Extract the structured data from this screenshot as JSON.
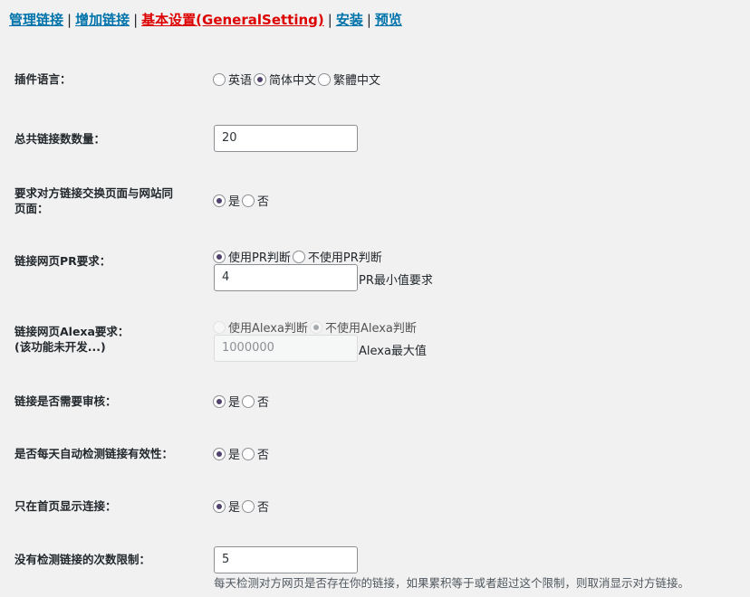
{
  "nav": {
    "items": [
      "管理链接",
      "增加链接",
      "基本设置(GeneralSetting)",
      "安装",
      "预览"
    ],
    "separator": "|",
    "active_color": "#dd0000",
    "link_color": "#0073aa"
  },
  "settings": {
    "language": {
      "label": "插件语言：",
      "options": [
        "英语",
        "简体中文",
        "繁體中文"
      ],
      "selected": "简体中文"
    },
    "total_links": {
      "label": "总共链接数数量：",
      "value": "20"
    },
    "same_page": {
      "label_line1": "要求对方链接交换页面与网站同",
      "label_line2": "页面：",
      "options": [
        "是",
        "否"
      ],
      "selected": "是"
    },
    "pr": {
      "label": "链接网页PR要求：",
      "options": [
        "使用PR判断",
        "不使用PR判断"
      ],
      "selected": "使用PR判断",
      "value": "4",
      "suffix": "PR最小值要求"
    },
    "alexa": {
      "label_line1": "链接网页Alexa要求：",
      "label_line2": "(该功能未开发...)",
      "options": [
        "使用Alexa判断",
        "不使用Alexa判断"
      ],
      "selected": "不使用Alexa判断",
      "placeholder": "1000000",
      "suffix": "Alexa最大值"
    },
    "review": {
      "label": "链接是否需要审核：",
      "options": [
        "是",
        "否"
      ],
      "selected": "是"
    },
    "daily_check": {
      "label": "是否每天自动检测链接有效性：",
      "options": [
        "是",
        "否"
      ],
      "selected": "是"
    },
    "homepage_only": {
      "label": "只在首页显示连接：",
      "options": [
        "是",
        "否"
      ],
      "selected": "是"
    },
    "check_limit": {
      "label": "没有检测链接的次数限制：",
      "value": "5",
      "description": "每天检测对方网页是否存在你的链接，如果累积等于或者超过这个限制，则取消显示对方链接。"
    }
  }
}
